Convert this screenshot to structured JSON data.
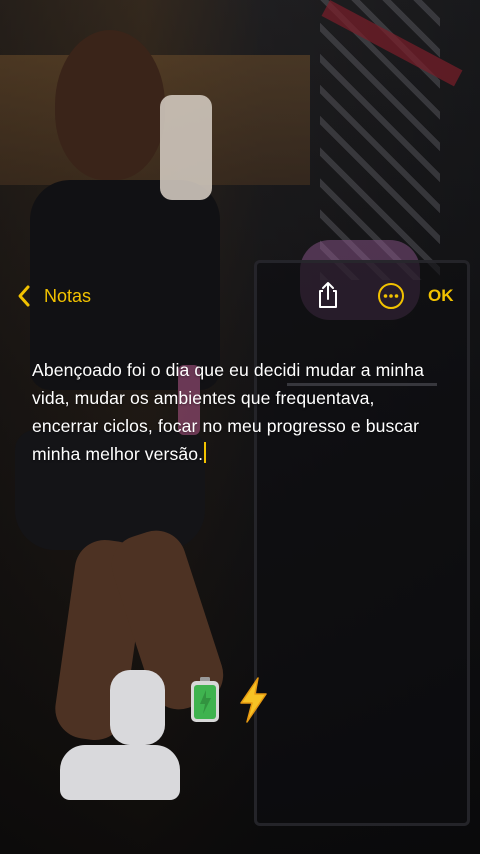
{
  "navbar": {
    "back_label": "Notas",
    "done_label": "OK"
  },
  "note": {
    "text": "Abençoado foi o dia que eu decidi mudar a minha vida, mudar os ambientes que frequentava, encerrar ciclos, focar no meu progresso e buscar minha melhor versão."
  },
  "stickers": [
    "battery-icon",
    "high-voltage-icon"
  ],
  "colors": {
    "accent": "#f2c200",
    "text": "#ffffff"
  }
}
